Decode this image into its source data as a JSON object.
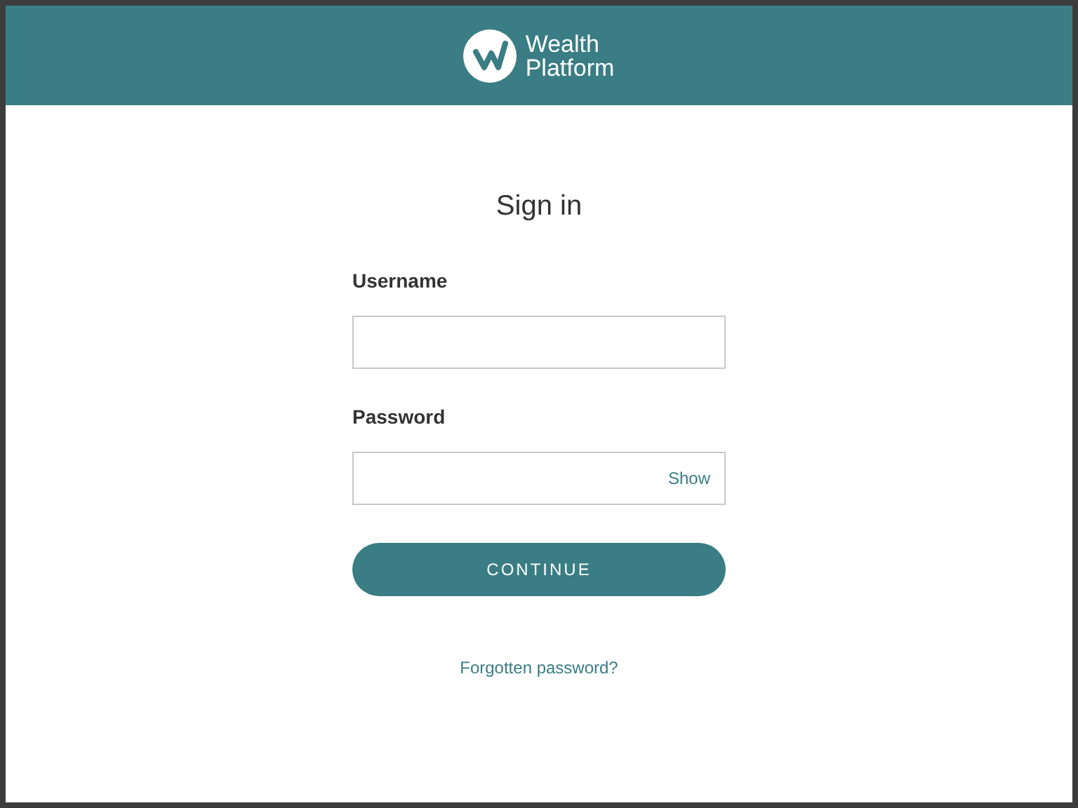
{
  "header": {
    "logo_line_1": "Wealth",
    "logo_line_2": "Platform"
  },
  "title": "Sign in",
  "fields": [
    {
      "label": "Username",
      "kind": "text"
    },
    {
      "label": "Password",
      "kind": "password",
      "toggle": "Show"
    }
  ],
  "button": "CONTINUE",
  "link": "Forgotten password?"
}
